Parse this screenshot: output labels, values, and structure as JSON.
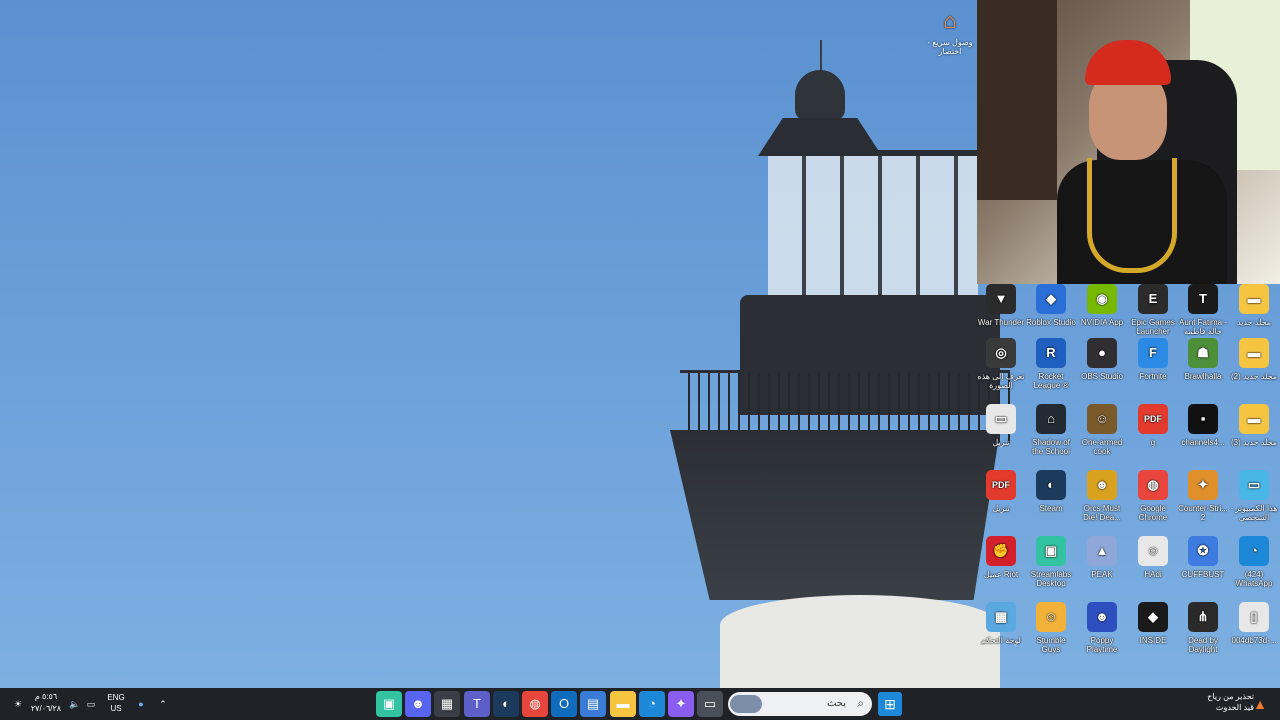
{
  "desktop_shortcut": {
    "label": "وصول سريع - اختصار",
    "icon": "home-icon"
  },
  "desktop_icons": [
    {
      "label": "War Thunder",
      "icon": "warthunder-icon",
      "color": "#2b2b2b",
      "glyph": "▼"
    },
    {
      "label": "Roblox Studio",
      "icon": "roblox-icon",
      "color": "#2a6ed8",
      "glyph": "◆"
    },
    {
      "label": "NVIDIA App",
      "icon": "nvidia-icon",
      "color": "#76b900",
      "glyph": "◉"
    },
    {
      "label": "Epic Games Launcher",
      "icon": "epic-icon",
      "color": "#2b2b2b",
      "glyph": "E"
    },
    {
      "label": "Aunt Fatima - خالة فاطمة",
      "icon": "game-icon",
      "color": "#1a1a1a",
      "glyph": "T"
    },
    {
      "label": "مجلد جديد",
      "icon": "folder-icon",
      "color": "#f5c542",
      "glyph": "▬"
    },
    {
      "label": "تعرف إلى هذه الصورة",
      "icon": "camera-info-icon",
      "color": "#3a3a3a",
      "glyph": "◎"
    },
    {
      "label": "Rocket League ®",
      "icon": "rocketleague-icon",
      "color": "#1f5fbf",
      "glyph": "R"
    },
    {
      "label": "OBS Studio",
      "icon": "obs-icon",
      "color": "#302e31",
      "glyph": "●"
    },
    {
      "label": "Fortnite",
      "icon": "fortnite-icon",
      "color": "#2a8ae6",
      "glyph": "F"
    },
    {
      "label": "Brawlhalla",
      "icon": "brawlhalla-icon",
      "color": "#4e8f3a",
      "glyph": "☗"
    },
    {
      "label": "مجلد جديد (2)",
      "icon": "folder-icon",
      "color": "#f5c542",
      "glyph": "▬"
    },
    {
      "label": "تنزيل",
      "icon": "download-file-icon",
      "color": "#e8e8e8",
      "glyph": "▭"
    },
    {
      "label": "Shadow of the School",
      "icon": "game-icon",
      "color": "#222a33",
      "glyph": "⌂"
    },
    {
      "label": "One-armed cook",
      "icon": "game-icon",
      "color": "#7a5a2a",
      "glyph": "☺"
    },
    {
      "label": "g",
      "icon": "pdf-icon",
      "color": "#e23b2e",
      "glyph": "PDF"
    },
    {
      "label": "channels4...",
      "icon": "image-file-icon",
      "color": "#111111",
      "glyph": "▪"
    },
    {
      "label": "مجلد جديد (3)",
      "icon": "folder-icon",
      "color": "#f5c542",
      "glyph": "▬"
    },
    {
      "label": "تنزيل",
      "icon": "pdf-icon",
      "color": "#e23b2e",
      "glyph": "PDF"
    },
    {
      "label": "Steam",
      "icon": "steam-icon",
      "color": "#1b3a5c",
      "glyph": "◐"
    },
    {
      "label": "Orcs Must Die! Dea...",
      "icon": "game-icon",
      "color": "#d8a21e",
      "glyph": "☻"
    },
    {
      "label": "Google Chrome",
      "icon": "chrome-icon",
      "color": "#e8453c",
      "glyph": "◍"
    },
    {
      "label": "Counter-Stri... 2",
      "icon": "counterstrike-icon",
      "color": "#e0902a",
      "glyph": "✦"
    },
    {
      "label": "هذا الكمبيوتر - الشخصي",
      "icon": "computer-icon",
      "color": "#49b6e8",
      "glyph": "▭"
    },
    {
      "label": "عميل Riot",
      "icon": "riot-icon",
      "color": "#d3212c",
      "glyph": "✊"
    },
    {
      "label": "Streamlabs Desktop",
      "icon": "streamlabs-icon",
      "color": "#31c3a2",
      "glyph": "▣"
    },
    {
      "label": "PEAK",
      "icon": "peak-icon",
      "color": "#8fa6d8",
      "glyph": "▲"
    },
    {
      "label": "HAdi",
      "icon": "image-file-icon",
      "color": "#e8e8e8",
      "glyph": "☺"
    },
    {
      "label": "CUFFBUST",
      "icon": "game-icon",
      "color": "#3d7be0",
      "glyph": "✪"
    },
    {
      "label": "(424) WhatsApp",
      "icon": "edge-icon",
      "color": "#1e88d8",
      "glyph": "◔"
    },
    {
      "label": "لوحة التحكم",
      "icon": "control-panel-icon",
      "color": "#5aa8e0",
      "glyph": "▦"
    },
    {
      "label": "Stumble Guys",
      "icon": "stumbleguys-icon",
      "color": "#f2b23a",
      "glyph": "☺"
    },
    {
      "label": "Poppy Playtime",
      "icon": "poppyplaytime-icon",
      "color": "#2d4fbf",
      "glyph": "☻"
    },
    {
      "label": "INSIDE",
      "icon": "inside-icon",
      "color": "#1a1a1a",
      "glyph": "◆"
    },
    {
      "label": "Dead by Daylight",
      "icon": "deadbydaylight-icon",
      "color": "#2a2a2a",
      "glyph": "⋔"
    },
    {
      "label": "004db73d-...",
      "icon": "phone-file-icon",
      "color": "#e8e8e8",
      "glyph": "▯"
    }
  ],
  "taskbar": {
    "clock_time": "٥:٥٦ م",
    "clock_date": "٢٧/٠٦/٢٨",
    "lang_top": "ENG",
    "lang_bottom": "US",
    "search_placeholder": "بحث",
    "notification_title": "تحذير من رياح",
    "notification_sub": "قيد الحدوث",
    "apps": [
      {
        "icon": "streamlabs-icon",
        "color": "#31c3a2",
        "glyph": "▣"
      },
      {
        "icon": "discord-icon",
        "color": "#5865f2",
        "glyph": "☻"
      },
      {
        "icon": "widgets-icon",
        "color": "#3a3f47",
        "glyph": "▦"
      },
      {
        "icon": "teams-icon",
        "color": "#5b5fc7",
        "glyph": "T"
      },
      {
        "icon": "steam-icon",
        "color": "#1b3a5c",
        "glyph": "◐"
      },
      {
        "icon": "chrome-icon",
        "color": "#e8453c",
        "glyph": "◍"
      },
      {
        "icon": "outlook-icon",
        "color": "#0f6cbd",
        "glyph": "O"
      },
      {
        "icon": "store-icon",
        "color": "#3a7bd5",
        "glyph": "▤"
      },
      {
        "icon": "file-explorer-icon",
        "color": "#f5c542",
        "glyph": "▬"
      },
      {
        "icon": "edge-icon",
        "color": "#1e88d8",
        "glyph": "◔"
      },
      {
        "icon": "copilot-icon",
        "color": "#8a5cf0",
        "glyph": "✦"
      },
      {
        "icon": "taskview-icon",
        "color": "#4a4f57",
        "glyph": "▭"
      }
    ]
  }
}
